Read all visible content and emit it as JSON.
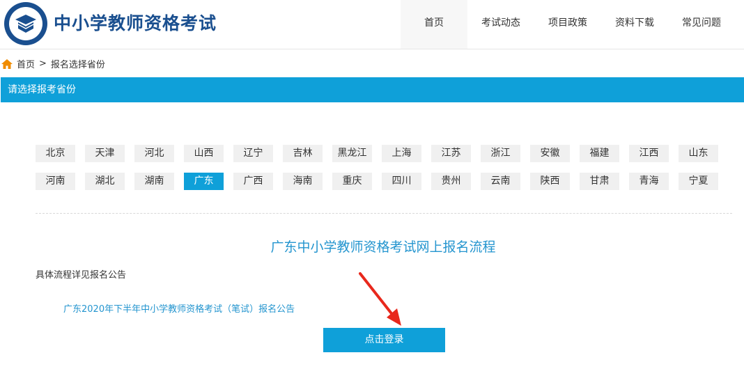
{
  "header": {
    "site_title": "中小学教师资格考试",
    "logo_icon": "seal-logo-icon",
    "nav": [
      {
        "label": "首页",
        "active": true
      },
      {
        "label": "考试动态",
        "active": false
      },
      {
        "label": "项目政策",
        "active": false
      },
      {
        "label": "资料下载",
        "active": false
      },
      {
        "label": "常见问题",
        "active": false
      }
    ]
  },
  "breadcrumb": {
    "icon": "home-icon",
    "home": "首页",
    "separator": ">",
    "current": "报名选择省份"
  },
  "section_title": "请选择报考省份",
  "provinces": {
    "row1": [
      "北京",
      "天津",
      "河北",
      "山西",
      "辽宁",
      "吉林",
      "黑龙江",
      "上海",
      "江苏",
      "浙江",
      "安徽",
      "福建",
      "江西",
      "山东"
    ],
    "row2": [
      "河南",
      "湖北",
      "湖南",
      "广东",
      "广西",
      "海南",
      "重庆",
      "四川",
      "贵州",
      "云南",
      "陕西",
      "甘肃",
      "青海",
      "宁夏"
    ],
    "selected": "广东"
  },
  "flow": {
    "title": "广东中小学教师资格考试网上报名流程",
    "subtitle": "具体流程详见报名公告",
    "notice_link": "广东2020年下半年中小学教师资格考试（笔试）报名公告",
    "login_button": "点击登录"
  },
  "colors": {
    "accent": "#0fa0d9",
    "link": "#2495cf",
    "title": "#1a4f8f",
    "arrow": "#e8281c"
  }
}
